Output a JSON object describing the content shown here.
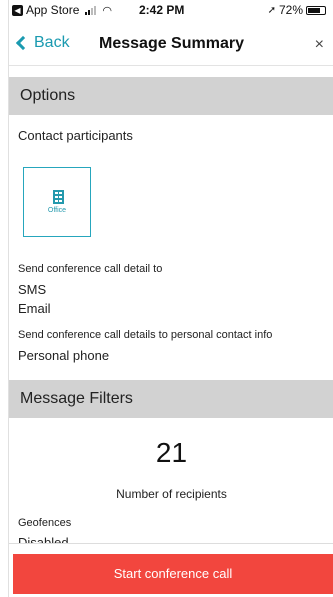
{
  "status_bar": {
    "app_back": "App Store",
    "time": "2:42 PM",
    "battery": "72%",
    "battery_level": 0.72
  },
  "nav": {
    "back_label": "Back",
    "title": "Message Summary",
    "close_glyph": "×"
  },
  "options": {
    "header": "Options",
    "contact_label": "Contact participants",
    "tile_label": "Office",
    "send_detail_label": "Send conference call detail to",
    "send_methods": [
      "SMS",
      "Email"
    ],
    "personal_label": "Send conference call details to personal contact info",
    "personal_value": "Personal phone"
  },
  "filters": {
    "header": "Message Filters",
    "recipient_count": "21",
    "recipient_label": "Number of recipients",
    "geofences_label": "Geofences",
    "geofences_value": "Disabled"
  },
  "cta": {
    "label": "Start conference call",
    "color": "#f2463e"
  },
  "colors": {
    "accent": "#1a9ab0",
    "header_bg": "#d2d2d2"
  }
}
